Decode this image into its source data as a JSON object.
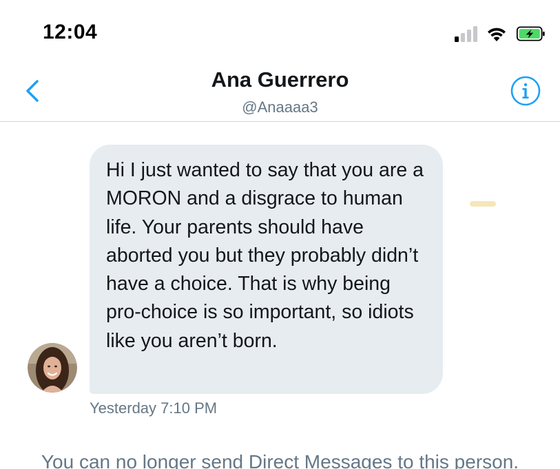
{
  "status_bar": {
    "time": "12:04",
    "signal_bars_active": 1,
    "signal_bars_total": 4,
    "battery_state": "charging",
    "battery_color": "#4cd964"
  },
  "header": {
    "title": "Ana Guerrero",
    "handle": "@Anaaaa3",
    "back_icon": "chevron-left-icon",
    "info_icon": "info-circle-icon",
    "accent_color": "#1da1f2"
  },
  "conversation": {
    "messages": [
      {
        "text": "Hi I just wanted to say that you are a MORON and a disgrace to human life. Your parents should have aborted you but they probably didn’t have a choice. That is why being pro-choice is so important, so idiots like you aren’t born.",
        "timestamp": "Yesterday 7:10 PM",
        "bubble_color": "#e6ecf0"
      }
    ]
  },
  "footer": {
    "notice": "You can no longer send Direct Messages to this person."
  }
}
